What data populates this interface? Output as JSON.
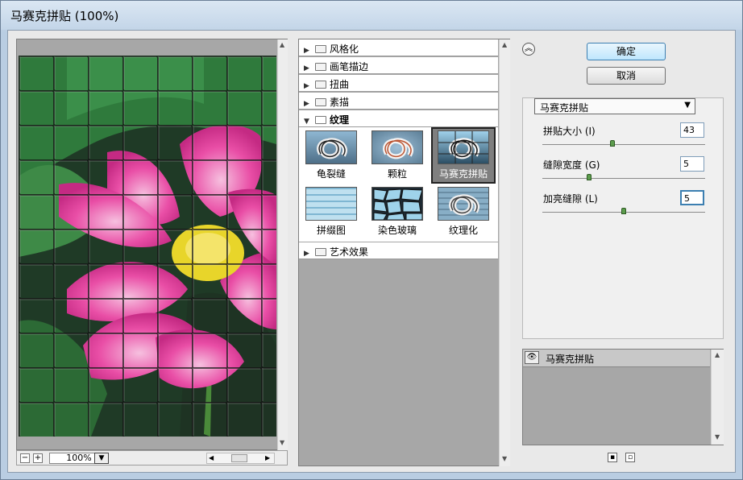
{
  "window": {
    "title": "马赛克拼贴 (100%)"
  },
  "preview": {
    "zoom_value": "100%",
    "zoom_minus": "−",
    "zoom_plus": "+"
  },
  "gallery": {
    "categories": [
      {
        "label": "风格化",
        "expanded": false
      },
      {
        "label": "画笔描边",
        "expanded": false
      },
      {
        "label": "扭曲",
        "expanded": false
      },
      {
        "label": "素描",
        "expanded": false
      },
      {
        "label": "纹理",
        "expanded": true
      },
      {
        "label": "艺术效果",
        "expanded": false
      }
    ],
    "texture_filters": [
      {
        "label": "龟裂缝",
        "selected": false
      },
      {
        "label": "颗粒",
        "selected": false
      },
      {
        "label": "马赛克拼贴",
        "selected": true
      },
      {
        "label": "拼缀图",
        "selected": false
      },
      {
        "label": "染色玻璃",
        "selected": false
      },
      {
        "label": "纹理化",
        "selected": false
      }
    ]
  },
  "actions": {
    "ok_label": "确定",
    "cancel_label": "取消"
  },
  "settings": {
    "filter_select": "马赛克拼贴",
    "params": [
      {
        "label": "拼贴大小 (I)",
        "value": "43",
        "slider_fraction": 0.43
      },
      {
        "label": "缝隙宽度 (G)",
        "value": "5",
        "slider_fraction": 0.28
      },
      {
        "label": "加亮缝隙 (L)",
        "value": "5",
        "slider_fraction": 0.5
      }
    ]
  },
  "layers": {
    "items": [
      {
        "name": "马赛克拼贴",
        "visible": true
      }
    ]
  },
  "colors": {
    "selection_accent": "#3c7fb1",
    "tile_grout": "#1a1a1a",
    "petal": "#e84fa6",
    "leaf": "#2f7a3c"
  }
}
